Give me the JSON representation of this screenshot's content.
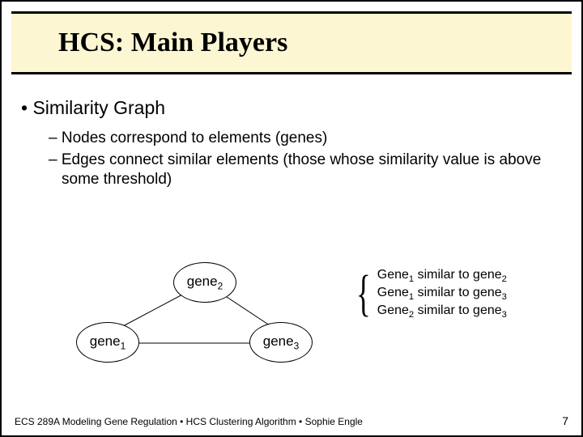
{
  "header": {
    "title": "HCS: Main Players"
  },
  "body": {
    "topic": "Similarity Graph",
    "points": [
      "Nodes correspond to elements (genes)",
      "Edges connect similar elements (those whose similarity value is above some threshold)"
    ]
  },
  "graph": {
    "nodes": {
      "n1": {
        "label": "gene",
        "sub": "1"
      },
      "n2": {
        "label": "gene",
        "sub": "2"
      },
      "n3": {
        "label": "gene",
        "sub": "3"
      }
    },
    "annotations": {
      "a1": {
        "pre": "Gene",
        "s1": "1",
        "mid": " similar to gene",
        "s2": "2"
      },
      "a2": {
        "pre": "Gene",
        "s1": "1",
        "mid": " similar to gene",
        "s2": "3"
      },
      "a3": {
        "pre": "Gene",
        "s1": "2",
        "mid": " similar to gene",
        "s2": "3"
      }
    }
  },
  "footer": {
    "text": "ECS 289A Modeling Gene Regulation • HCS Clustering Algorithm • Sophie Engle",
    "page": "7"
  }
}
